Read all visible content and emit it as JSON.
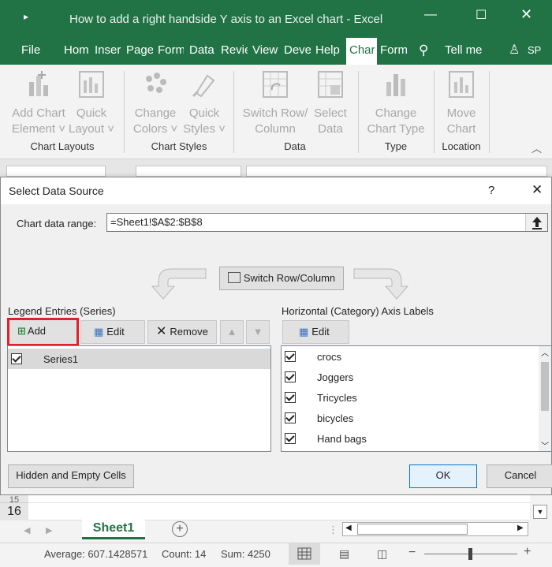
{
  "app": {
    "title": "How to add a right handside Y axis to an Excel chart  -  Excel",
    "user_initials": "SP"
  },
  "menu": {
    "tabs": [
      "File",
      "Hom",
      "Inser",
      "Page",
      "Form",
      "Data",
      "Revie",
      "View",
      "Deve",
      "Help",
      "Char",
      "Form"
    ],
    "selected": "Char",
    "tell_me": "Tell me"
  },
  "ribbon": {
    "add_chart_element": [
      "Add Chart",
      "Element ˅"
    ],
    "quick_layout": [
      "Quick",
      "Layout ˅"
    ],
    "change_colors": [
      "Change",
      "Colors ˅"
    ],
    "quick_styles": [
      "Quick",
      "Styles ˅"
    ],
    "switch_row_column": [
      "Switch Row/",
      "Column"
    ],
    "select_data": [
      "Select",
      "Data"
    ],
    "change_chart_type": [
      "Change",
      "Chart Type"
    ],
    "move_chart": [
      "Move",
      "Chart"
    ],
    "groups": {
      "chart_layouts": "Chart Layouts",
      "chart_styles": "Chart Styles",
      "data": "Data",
      "type": "Type",
      "location": "Location"
    }
  },
  "dialog": {
    "title": "Select Data Source",
    "help": "?",
    "range_label": "Chart data range:",
    "range_value": "=Sheet1!$A$2:$B$8",
    "switch_label": "Switch Row/Column",
    "legend_label": "Legend Entries (Series)",
    "axis_label": "Horizontal (Category) Axis Labels",
    "add": "Add",
    "edit": "Edit",
    "remove": "Remove",
    "axis_edit": "Edit",
    "series": [
      "Series1"
    ],
    "categories": [
      "crocs",
      "Joggers",
      "Tricycles",
      "bicycles",
      "Hand bags"
    ],
    "hidden_cells": "Hidden and Empty Cells",
    "ok": "OK",
    "cancel": "Cancel"
  },
  "sheet": {
    "row_15": "15",
    "row_16": "16",
    "tab": "Sheet1"
  },
  "status": {
    "average": "Average: 607.1428571",
    "count": "Count: 14",
    "sum": "Sum: 4250"
  },
  "colors": {
    "brand": "#217346",
    "highlight_outline": "#e0202a"
  }
}
